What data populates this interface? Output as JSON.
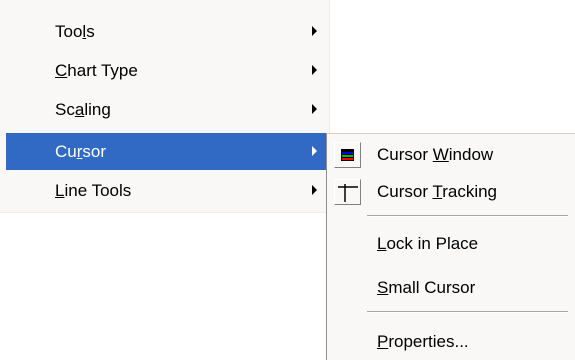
{
  "menu": {
    "items": [
      {
        "id": "tools",
        "label_before": "Too",
        "mnemonic": "l",
        "label_after": "s",
        "has_submenu": true
      },
      {
        "id": "chart-type",
        "label_before": "",
        "mnemonic": "C",
        "label_after": "hart Type",
        "has_submenu": true
      },
      {
        "id": "scaling",
        "label_before": "Sc",
        "mnemonic": "a",
        "label_after": "ling",
        "has_submenu": true
      },
      {
        "id": "cursor",
        "label_before": "Cu",
        "mnemonic": "r",
        "label_after": "sor",
        "has_submenu": true,
        "selected": true
      },
      {
        "id": "line-tools",
        "label_before": "",
        "mnemonic": "L",
        "label_after": "ine Tools",
        "has_submenu": true
      }
    ],
    "selected_background": "#316ac5"
  },
  "submenu": {
    "items": [
      {
        "id": "cursor-window",
        "label_before": "Cursor ",
        "mnemonic": "W",
        "label_after": "indow",
        "icon": "cursor-window-icon"
      },
      {
        "id": "cursor-tracking",
        "label_before": "Cursor ",
        "mnemonic": "T",
        "label_after": "racking",
        "icon": "crosshair-icon"
      },
      {
        "id": "lock-in-place",
        "label_before": "",
        "mnemonic": "L",
        "label_after": "ock in Place"
      },
      {
        "id": "small-cursor",
        "label_before": "",
        "mnemonic": "S",
        "label_after": "mall Cursor"
      },
      {
        "id": "properties",
        "label_before": "",
        "mnemonic": "P",
        "label_after": "roperties..."
      }
    ]
  }
}
